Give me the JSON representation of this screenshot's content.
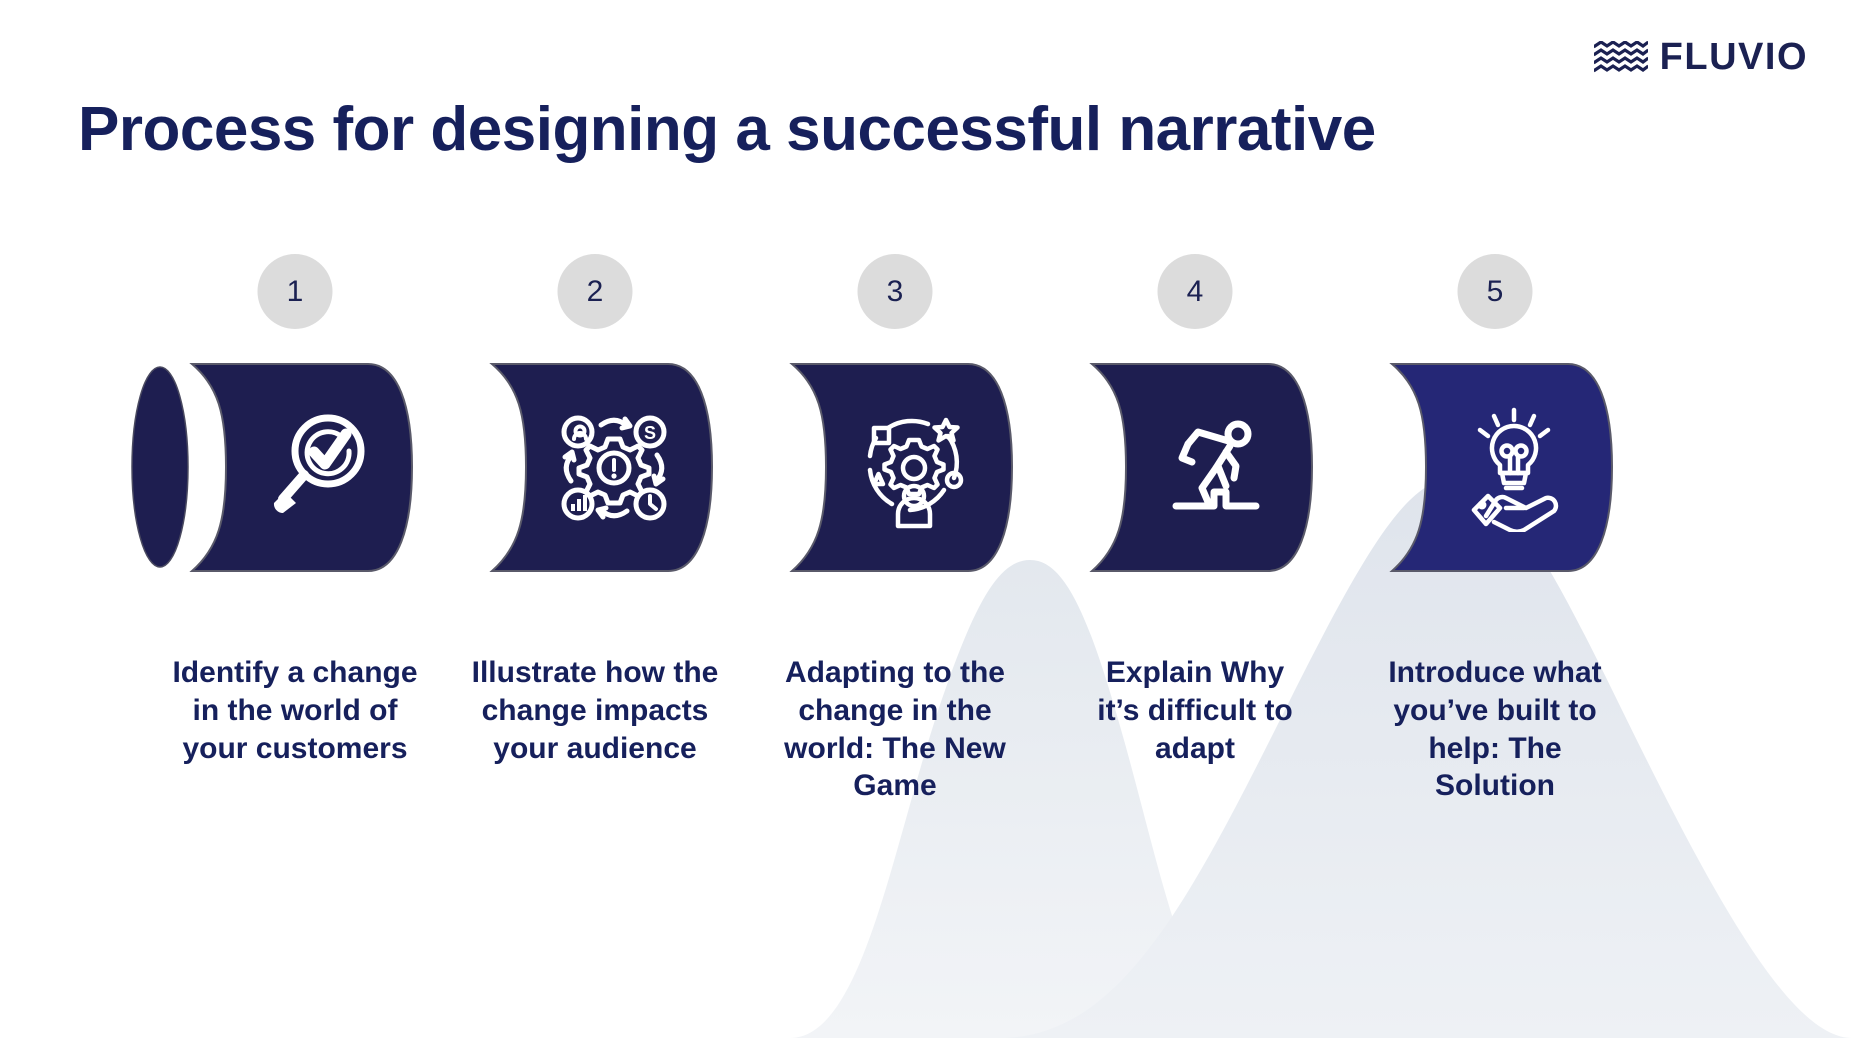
{
  "brand": {
    "name": "FLUVIO",
    "mark": "waves-icon",
    "color": "#1b2152"
  },
  "slide": {
    "title": "Process for designing a successful narrative",
    "background": "#ffffff",
    "title_color": "#16205c",
    "accent_color": "#1e1e50",
    "highlight_color": "#252776",
    "number_circle_color": "#dcdcdc",
    "decoration": "mountain-silhouette"
  },
  "steps": [
    {
      "number": "1",
      "icon": "magnifier-check-icon",
      "caption": "Identify a change in the world of your customers",
      "color": "#1e1e50",
      "has_end_cap": true
    },
    {
      "number": "2",
      "icon": "gear-impact-cycle-icon",
      "caption": "Illustrate how the change impacts your audience",
      "color": "#1e1e50",
      "has_end_cap": false
    },
    {
      "number": "3",
      "icon": "gear-orbit-person-icon",
      "caption": "Adapting to the change in the world: The New Game",
      "color": "#1e1e50",
      "has_end_cap": false
    },
    {
      "number": "4",
      "icon": "person-stumbling-icon",
      "caption": "Explain Why it’s difficult to adapt",
      "color": "#1e1e50",
      "has_end_cap": false
    },
    {
      "number": "5",
      "icon": "lightbulb-hand-icon",
      "caption": "Introduce what you’ve built to help: The Solution",
      "color": "#252776",
      "has_end_cap": false
    }
  ]
}
